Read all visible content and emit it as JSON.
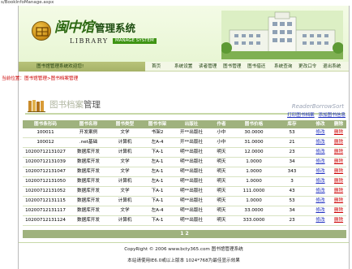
{
  "browser": {
    "url": "s/BookInfoManage.aspx"
  },
  "header": {
    "logo_script": "闽中馆",
    "logo_title": "管理系统",
    "logo_library": "LIBRARY",
    "logo_system": "MANAGE SYSTEM"
  },
  "welcome": "图书馆管理系统欢迎您!",
  "nav": [
    "首页",
    "系统设置",
    "读者管理",
    "图书管理",
    "图书借还",
    "系统查询",
    "更改口令",
    "退出系统"
  ],
  "breadcrumb": "当前位置：图书馆管理>图书档案管理",
  "section": {
    "title_faint": "图书档案",
    "title": "管理"
  },
  "watermark": "ReaderBorrowSort",
  "links": {
    "print": "打印图书档案",
    "add": "添加图书信息"
  },
  "table": {
    "columns": [
      "图书条形码",
      "图书名称",
      "图书类型",
      "图书书架",
      "出版社",
      "作者",
      "图书价格",
      "库存",
      "修改",
      "删除"
    ],
    "rows": [
      [
        "100011",
        "开发案例",
        "文学",
        "书架2",
        "开**出版社",
        "小中",
        "30.0000",
        "53",
        "修改",
        "删除"
      ],
      [
        "100012",
        ".net基础",
        "计算机",
        "左A-4",
        "开**出版社",
        "小中",
        "31.0000",
        "21",
        "修改",
        "删除"
      ],
      [
        "10200712131027",
        "数据库开发",
        "计算机",
        "下A-1",
        "明**出版社",
        "明天",
        "12.0000",
        "23",
        "修改",
        "删除"
      ],
      [
        "10200712131039",
        "数据库开发",
        "文学",
        "左A-1",
        "明**出版社",
        "明天",
        "1.0000",
        "34",
        "修改",
        "删除"
      ],
      [
        "10200712131047",
        "数据库开发",
        "文学",
        "左A-1",
        "明**出版社",
        "明天",
        "1.0000",
        "343",
        "修改",
        "删除"
      ],
      [
        "10200712131050",
        "数据库开发",
        "计算机",
        "左A-1",
        "明**出版社",
        "明天",
        "1.0000",
        "3",
        "修改",
        "删除"
      ],
      [
        "10200712131052",
        "数据库开发",
        "文学",
        "下A-1",
        "明**出版社",
        "明天",
        "111.0000",
        "43",
        "修改",
        "删除"
      ],
      [
        "10200712131115",
        "数据库开发",
        "计算机",
        "下A-1",
        "明**出版社",
        "明天",
        "1.0000",
        "53",
        "修改",
        "删除"
      ],
      [
        "10200712131117",
        "数据库开发",
        "文学",
        "左A-4",
        "明**出版社",
        "明天",
        "33.0000",
        "34",
        "修改",
        "删除"
      ],
      [
        "10200712131124",
        "数据库开发",
        "计算机",
        "下A-1",
        "明**出版社",
        "明天",
        "333.0000",
        "23",
        "修改",
        "删除"
      ]
    ]
  },
  "pager": "1 2",
  "footer": {
    "copyright": "CopyRight © 2006 www.bcty365.com 图书馆管理系统",
    "recommend": "本站请使用IE6.0或以上版本 1024*768为最佳显示效果"
  },
  "colors": {
    "header_green": "#9fb27e",
    "link": "#1f2fbf",
    "delete": "#cc0000",
    "welcome_bar": "#b8c37a"
  }
}
